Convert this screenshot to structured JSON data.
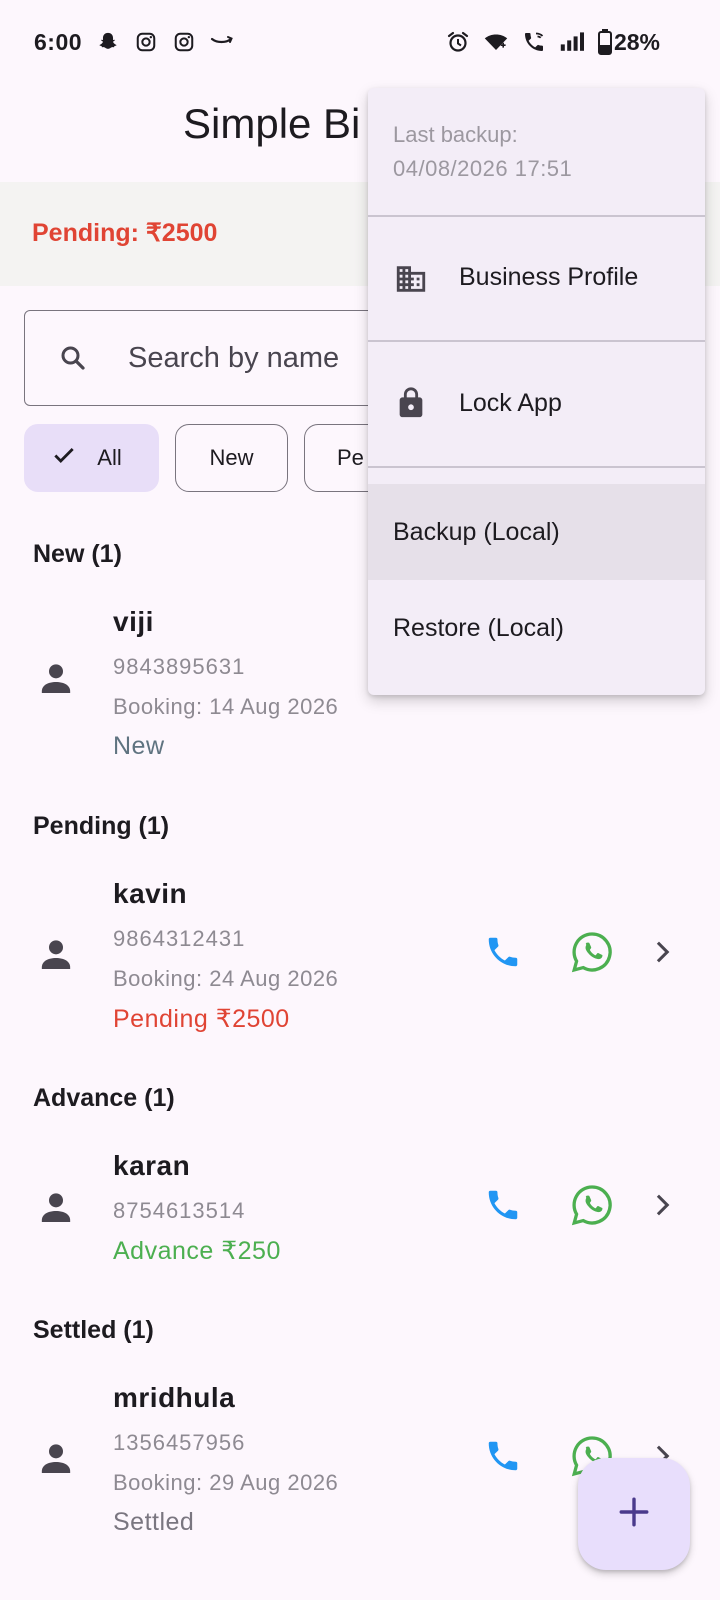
{
  "status_bar": {
    "time": "6:00",
    "battery": "28%",
    "left_icons": [
      "snapchat-icon",
      "instagram-icon",
      "instagram-icon",
      "amazon-icon"
    ],
    "right_icons": [
      "alarm-icon",
      "wifi-icon",
      "wifi-calling-icon",
      "signal-icon",
      "battery-icon"
    ]
  },
  "app": {
    "title": "Simple Bi"
  },
  "summary": {
    "pending": "Pending: ₹2500"
  },
  "search": {
    "placeholder": "Search by name"
  },
  "filters": [
    {
      "label": "All",
      "selected": true
    },
    {
      "label": "New",
      "selected": false
    },
    {
      "label": "Pe",
      "selected": false
    }
  ],
  "sections": [
    {
      "header": "New (1)",
      "contact": {
        "name": "viji",
        "phone": "9843895631",
        "booking": "Booking: 14 Aug 2026",
        "status": "New"
      }
    },
    {
      "header": "Pending (1)",
      "contact": {
        "name": "kavin",
        "phone": "9864312431",
        "booking": "Booking: 24 Aug 2026",
        "status": "Pending ₹2500"
      }
    },
    {
      "header": "Advance (1)",
      "contact": {
        "name": "karan",
        "phone": "8754613514",
        "booking": "",
        "status": "Advance ₹250"
      }
    },
    {
      "header": "Settled (1)",
      "contact": {
        "name": "mridhula",
        "phone": "1356457956",
        "booking": "Booking: 29 Aug 2026",
        "status": "Settled"
      }
    }
  ],
  "menu": {
    "last_backup_label": "Last backup:",
    "last_backup_value": "04/08/2026 17:51",
    "items": [
      {
        "label": "Business Profile",
        "icon": "business-icon"
      },
      {
        "label": "Lock App",
        "icon": "lock-icon"
      },
      {
        "label": "Backup (Local)",
        "icon": ""
      },
      {
        "label": "Restore (Local)",
        "icon": ""
      }
    ]
  },
  "colors": {
    "pending_red": "#e04434",
    "advance_green": "#4caf50",
    "new_status": "#5f7380",
    "settled_status": "#7a7680",
    "call_blue": "#2196f3",
    "whatsapp_green": "#4caf50",
    "chip_selected": "#e8def8",
    "fab_bg": "#e8defc",
    "fab_plus": "#4a3a8c"
  }
}
